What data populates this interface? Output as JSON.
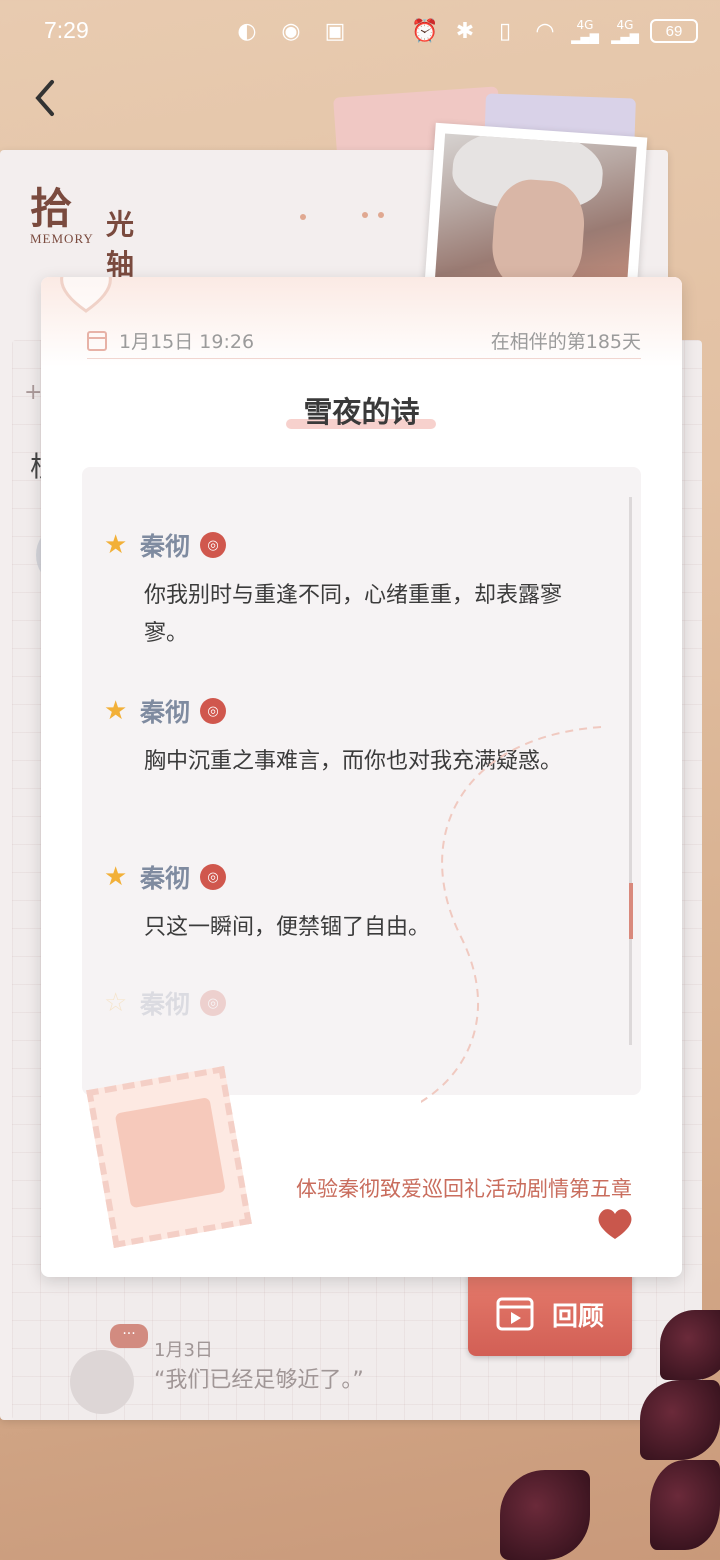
{
  "status_bar": {
    "time": "7:29",
    "battery": "69",
    "signal_labels": [
      "4G",
      "4G"
    ]
  },
  "background": {
    "logo_zh_big": "拾",
    "logo_zh_small": "光轴",
    "logo_en": "MEMORY",
    "plus_glyph": "+",
    "clipped_char": "核",
    "entry": {
      "bubble": "···",
      "date": "1月3日",
      "quote": "“我们已经足够近了。”"
    },
    "review_button": "回顾"
  },
  "card": {
    "date": "1月15日 19:26",
    "days_together": "在相伴的第185天",
    "title": "雪夜的诗",
    "lines": [
      {
        "speaker": "秦彻",
        "text": "你我别时与重逢不同，心绪重重，却表露寥寥。",
        "starred": true
      },
      {
        "speaker": "秦彻",
        "text": "胸中沉重之事难言，而你也对我充满疑惑。",
        "starred": true
      },
      {
        "speaker": "秦彻",
        "text": "只这一瞬间，便禁锢了自由。",
        "starred": true
      },
      {
        "speaker": "秦彻",
        "text": "",
        "starred": false
      }
    ],
    "activity_link": "体验秦彻致爱巡回礼活动剧情第五章"
  },
  "colors": {
    "accent": "#d0574d",
    "star": "#f2b038",
    "speaker": "#7f8ba0",
    "link": "#c96d5d"
  },
  "icons": [
    "back-icon",
    "calendar-icon",
    "star-icon",
    "voice-icon",
    "heart-icon",
    "film-location-icon"
  ]
}
